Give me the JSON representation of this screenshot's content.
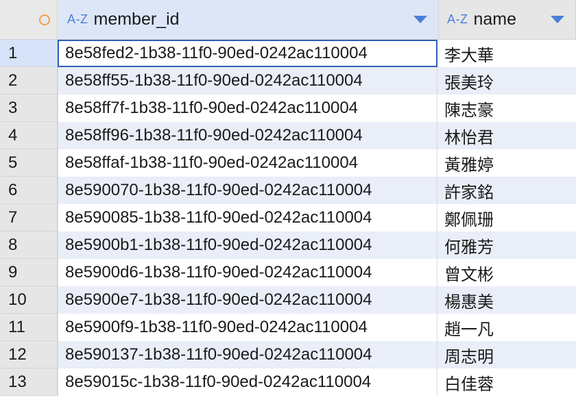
{
  "header": {
    "corner_icon": "circle-icon",
    "columns": [
      {
        "type_badge": "A-Z",
        "title": "member_id"
      },
      {
        "type_badge": "A-Z",
        "title": "name"
      }
    ]
  },
  "rows": [
    {
      "num": "1",
      "member_id": "8e58fed2-1b38-11f0-90ed-0242ac110004",
      "name": "李大華"
    },
    {
      "num": "2",
      "member_id": "8e58ff55-1b38-11f0-90ed-0242ac110004",
      "name": "張美玲"
    },
    {
      "num": "3",
      "member_id": "8e58ff7f-1b38-11f0-90ed-0242ac110004",
      "name": "陳志豪"
    },
    {
      "num": "4",
      "member_id": "8e58ff96-1b38-11f0-90ed-0242ac110004",
      "name": "林怡君"
    },
    {
      "num": "5",
      "member_id": "8e58ffaf-1b38-11f0-90ed-0242ac110004",
      "name": "黃雅婷"
    },
    {
      "num": "6",
      "member_id": "8e590070-1b38-11f0-90ed-0242ac110004",
      "name": "許家銘"
    },
    {
      "num": "7",
      "member_id": "8e590085-1b38-11f0-90ed-0242ac110004",
      "name": "鄭佩珊"
    },
    {
      "num": "8",
      "member_id": "8e5900b1-1b38-11f0-90ed-0242ac110004",
      "name": "何雅芳"
    },
    {
      "num": "9",
      "member_id": "8e5900d6-1b38-11f0-90ed-0242ac110004",
      "name": "曾文彬"
    },
    {
      "num": "10",
      "member_id": "8e5900e7-1b38-11f0-90ed-0242ac110004",
      "name": "楊惠美"
    },
    {
      "num": "11",
      "member_id": "8e5900f9-1b38-11f0-90ed-0242ac110004",
      "name": "趙一凡"
    },
    {
      "num": "12",
      "member_id": "8e590137-1b38-11f0-90ed-0242ac110004",
      "name": "周志明"
    },
    {
      "num": "13",
      "member_id": "8e59015c-1b38-11f0-90ed-0242ac110004",
      "name": "白佳蓉"
    }
  ]
}
